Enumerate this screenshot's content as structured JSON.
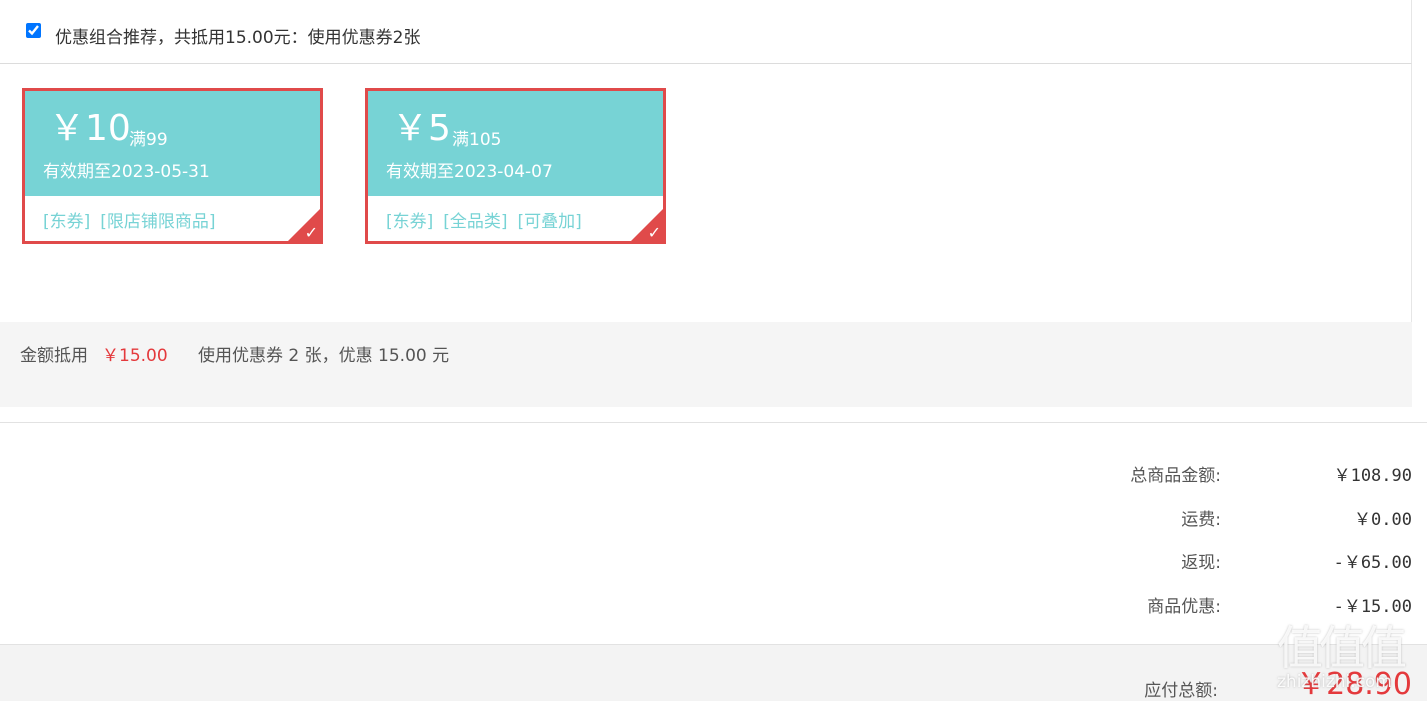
{
  "recommendation": {
    "checked": true,
    "text": "优惠组合推荐，共抵用15.00元：使用优惠券2张"
  },
  "coupons": [
    {
      "amount": "￥10",
      "condition": "满99",
      "expiry": "有效期至2023-05-31",
      "tags": [
        "[东券]",
        "[限店铺限商品]"
      ],
      "selected": true
    },
    {
      "amount": "￥5",
      "condition": "满105",
      "expiry": "有效期至2023-04-07",
      "tags": [
        "[东券]",
        "[全品类]",
        "[可叠加]"
      ],
      "selected": true
    }
  ],
  "summary": {
    "label": "金额抵用",
    "amount": "￥15.00",
    "description": "使用优惠券 2 张，优惠 15.00 元"
  },
  "totals": [
    {
      "label": "总商品金额:",
      "value": "￥108.90"
    },
    {
      "label": "运费:",
      "value": "￥0.00"
    },
    {
      "label": "返现:",
      "value": "-￥65.00"
    },
    {
      "label": "商品优惠:",
      "value": "-￥15.00"
    }
  ],
  "payable": {
    "label": "应付总额:",
    "value": "￥28.90"
  },
  "watermark": {
    "logo": "值值值",
    "url": "zhizhizhi.com"
  },
  "colors": {
    "accent_red": "#e04a4a",
    "price_red": "#e4393c",
    "coupon_teal": "#77d3d5"
  },
  "icons": {
    "selected_check": "checkmark-icon"
  }
}
